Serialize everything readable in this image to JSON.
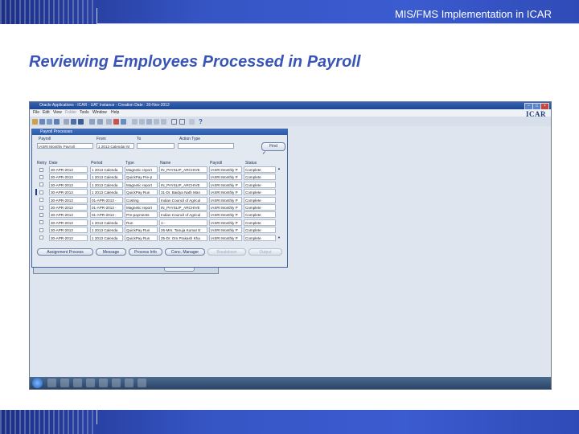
{
  "slide": {
    "header": "MIS/FMS Implementation in ICAR",
    "title": "Reviewing Employees Processed in Payroll"
  },
  "app": {
    "window_title": "Oracle Applications - ICAR - UAT Instance - Creation Date : 30-Nov-2012",
    "logo": "ICAR",
    "menu": [
      "File",
      "Edit",
      "View",
      "Folder",
      "Tools",
      "Window",
      "Help"
    ]
  },
  "form": {
    "title": "Payroll Processes",
    "labels": {
      "payroll": "Payroll",
      "from": "From",
      "to": "To",
      "action_type": "Action Type"
    },
    "values": {
      "payroll": "IASRI Monthly Payroll",
      "from": "1 2013 Calendar M",
      "to": "",
      "action_type": ""
    },
    "find_label": "Find",
    "columns": [
      "Retry",
      "Date",
      "Period",
      "Type",
      "Name",
      "Payroll",
      "Status"
    ],
    "rows": [
      {
        "date": "30-APR-2013",
        "period": "1 2013 Calenda",
        "type": "Magnetic report",
        "name": "IN_PAYSLIP_ARCHIVE",
        "payroll": "IASRI Monthly P",
        "status": "Complete"
      },
      {
        "date": "30-APR-2013",
        "period": "1 2013 Calenda",
        "type": "QuickPay Pre-p",
        "name": "",
        "payroll": "IASRI Monthly P",
        "status": "Complete"
      },
      {
        "date": "30-APR-2013",
        "period": "1 2013 Calenda",
        "type": "Magnetic report",
        "name": "IN_PAYSLIP_ARCHIVE",
        "payroll": "IASRI Monthly P",
        "status": "Complete"
      },
      {
        "date": "30-APR-2013",
        "period": "1 2013 Calenda",
        "type": "QuickPay Run",
        "name": "31-Dr. Baidya Nath Man",
        "payroll": "IASRI Monthly P",
        "status": "Complete"
      },
      {
        "date": "30-APR-2013",
        "period": "01-APR-2013 -",
        "type": "Costing",
        "name": "Indian Council of Agricul",
        "payroll": "IASRI Monthly P",
        "status": "Complete"
      },
      {
        "date": "30-APR-2013",
        "period": "01-APR-2013 -",
        "type": "Magnetic report",
        "name": "IN_PAYSLIP_ARCHIVE",
        "payroll": "IASRI Monthly P",
        "status": "Complete"
      },
      {
        "date": "30-APR-2013",
        "period": "01-APR-2013 -",
        "type": "Pre-payments",
        "name": "Indian Council of Agricul",
        "payroll": "IASRI Monthly P",
        "status": "Complete"
      },
      {
        "date": "30-APR-2013",
        "period": "1 2013 Calenda",
        "type": "Run",
        "name": "1--",
        "payroll": "IASRI Monthly P",
        "status": "Complete"
      },
      {
        "date": "30-APR-2013",
        "period": "1 2013 Calenda",
        "type": "QuickPay Run",
        "name": "26-Mrs. Tanuja Kumar E",
        "payroll": "IASRI Monthly P",
        "status": "Complete"
      },
      {
        "date": "30-APR-2013",
        "period": "1 2013 Calenda",
        "type": "QuickPay Run",
        "name": "25-Dr. Om Prakash Kha",
        "payroll": "IASRI Monthly P",
        "status": "Complete"
      }
    ],
    "buttons": [
      {
        "label": "Assignment Process",
        "enabled": true
      },
      {
        "label": "Message",
        "enabled": true
      },
      {
        "label": "Process Info",
        "enabled": true
      },
      {
        "label": "Conc. Manager",
        "enabled": true
      },
      {
        "label": "Breakdown",
        "enabled": false
      },
      {
        "label": "Output",
        "enabled": false
      }
    ]
  }
}
